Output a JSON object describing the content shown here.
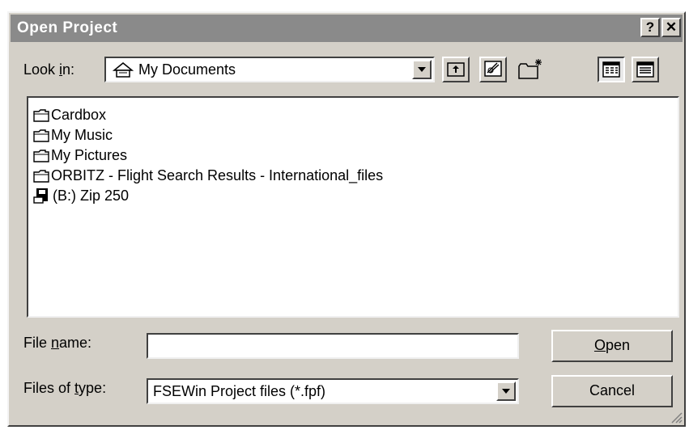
{
  "dialog": {
    "title": "Open Project",
    "help_button": "?",
    "close_button": "✕"
  },
  "look_in": {
    "label_pre": "Look ",
    "label_mnemonic": "i",
    "label_post": "n:",
    "value": "My Documents",
    "icon": "my-documents-icon"
  },
  "toolbar": {
    "buttons": [
      "up-one-level-icon",
      "desktop-icon",
      "create-new-folder-icon",
      "list-view-icon",
      "details-view-icon"
    ]
  },
  "file_list": {
    "items": [
      {
        "label": "Cardbox",
        "icon": "folder-icon"
      },
      {
        "label": "My Music",
        "icon": "folder-icon"
      },
      {
        "label": "My Pictures",
        "icon": "folder-icon"
      },
      {
        "label": "ORBITZ - Flight Search Results - International_files",
        "icon": "folder-icon"
      },
      {
        "label": "(B:) Zip 250",
        "icon": "zip-drive-icon"
      }
    ]
  },
  "file_name": {
    "label_pre": "File ",
    "label_mnemonic": "n",
    "label_post": "ame:",
    "value": ""
  },
  "file_type": {
    "label_pre": "Files of ",
    "label_mnemonic": "t",
    "label_post": "ype:",
    "value": "FSEWin Project files (*.fpf)"
  },
  "buttons": {
    "open_mnemonic": "O",
    "open_rest": "pen",
    "cancel": "Cancel"
  }
}
